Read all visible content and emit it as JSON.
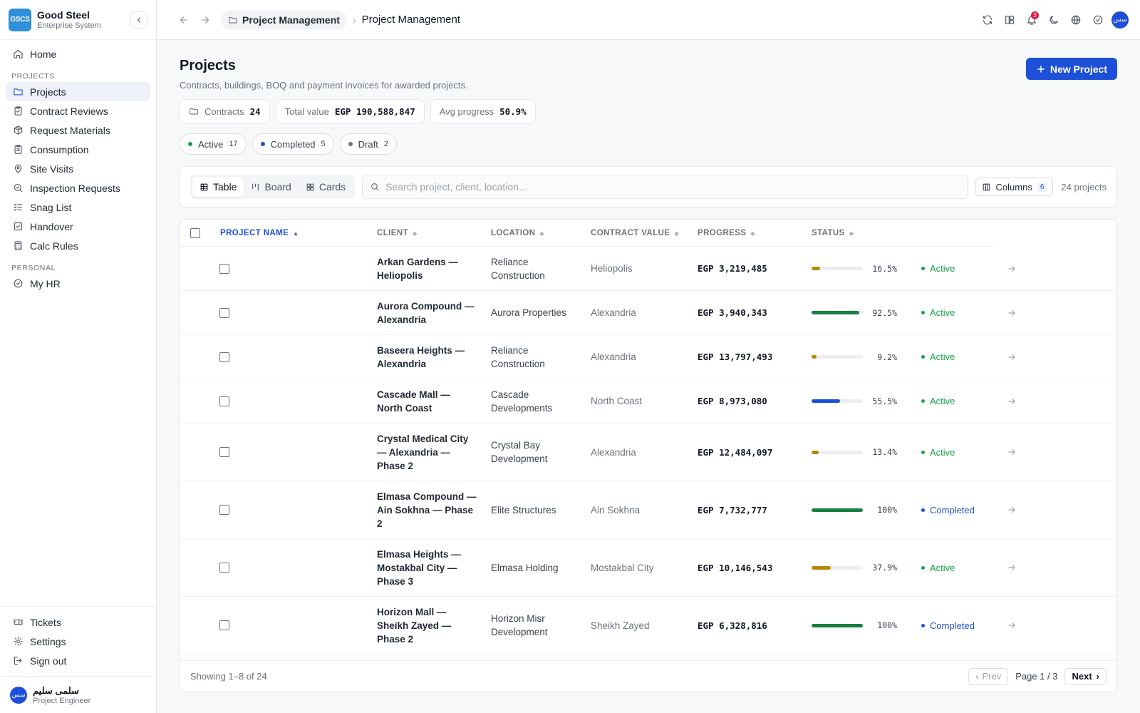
{
  "brand": {
    "logo": "GSCS",
    "name": "Good Steel",
    "subtitle": "Enterprise System"
  },
  "sidebar": {
    "home": "Home",
    "section_projects": "PROJECTS",
    "projects_items": [
      {
        "label": "Projects",
        "icon": "folder-icon",
        "active": true
      },
      {
        "label": "Contract Reviews",
        "icon": "clipboard-check-icon"
      },
      {
        "label": "Request Materials",
        "icon": "package-icon"
      },
      {
        "label": "Consumption",
        "icon": "clipboard-list-icon"
      },
      {
        "label": "Site Visits",
        "icon": "map-pin-icon"
      },
      {
        "label": "Inspection Requests",
        "icon": "search-check-icon"
      },
      {
        "label": "Snag List",
        "icon": "list-check-icon"
      },
      {
        "label": "Handover",
        "icon": "square-check-icon"
      },
      {
        "label": "Calc Rules",
        "icon": "calculator-icon"
      }
    ],
    "section_personal": "PERSONAL",
    "personal_items": [
      {
        "label": "My HR",
        "icon": "circle-check-icon"
      }
    ],
    "bottom_items": [
      {
        "label": "Tickets",
        "icon": "ticket-icon"
      },
      {
        "label": "Settings",
        "icon": "gear-icon"
      },
      {
        "label": "Sign out",
        "icon": "logout-icon"
      }
    ],
    "user": {
      "initials": "سس",
      "name": "سلمى سليم",
      "role": "Project Engineer"
    }
  },
  "topbar": {
    "breadcrumb_module": "Project Management",
    "breadcrumb_current": "Project Management",
    "notification_count": "3",
    "avatar_initials": "سس"
  },
  "page": {
    "title": "Projects",
    "subtitle": "Contracts, buildings, BOQ and payment invoices for awarded projects.",
    "new_button": "New Project"
  },
  "stats": [
    {
      "label": "Contracts",
      "value": "24"
    },
    {
      "label": "Total value",
      "value": "EGP 190,588,847"
    },
    {
      "label": "Avg progress",
      "value": "50.9%"
    }
  ],
  "filters": [
    {
      "label": "Active",
      "count": "17",
      "color": "#16a34a"
    },
    {
      "label": "Completed",
      "count": "5",
      "color": "#1e4fd8"
    },
    {
      "label": "Draft",
      "count": "2",
      "color": "#6b7280"
    }
  ],
  "toolbar": {
    "views": [
      "Table",
      "Board",
      "Cards"
    ],
    "active_view": "Table",
    "search_placeholder": "Search project, client, location...",
    "columns_label": "Columns",
    "columns_count": "6",
    "projects_count": "24 projects"
  },
  "table": {
    "columns": [
      "PROJECT NAME",
      "CLIENT",
      "LOCATION",
      "CONTRACT VALUE",
      "PROGRESS",
      "STATUS"
    ],
    "sorted_column": "PROJECT NAME",
    "rows": [
      {
        "name": "Arkan Gardens — Heliopolis",
        "client": "Reliance Construction",
        "location": "Heliopolis",
        "value": "EGP 3,219,485",
        "progress": 16.5,
        "progress_label": "16.5%",
        "status": "Active"
      },
      {
        "name": "Aurora Compound — Alexandria",
        "client": "Aurora Properties",
        "location": "Alexandria",
        "value": "EGP 3,940,343",
        "progress": 92.5,
        "progress_label": "92.5%",
        "status": "Active"
      },
      {
        "name": "Baseera Heights — Alexandria",
        "client": "Reliance Construction",
        "location": "Alexandria",
        "value": "EGP 13,797,493",
        "progress": 9.2,
        "progress_label": "9.2%",
        "status": "Active"
      },
      {
        "name": "Cascade Mall — North Coast",
        "client": "Cascade Developments",
        "location": "North Coast",
        "value": "EGP 8,973,080",
        "progress": 55.5,
        "progress_label": "55.5%",
        "status": "Active"
      },
      {
        "name": "Crystal Medical City — Alexandria — Phase 2",
        "client": "Crystal Bay Development",
        "location": "Alexandria",
        "value": "EGP 12,484,097",
        "progress": 13.4,
        "progress_label": "13.4%",
        "status": "Active"
      },
      {
        "name": "Elmasa Compound — Ain Sokhna — Phase 2",
        "client": "Elite Structures",
        "location": "Ain Sokhna",
        "value": "EGP 7,732,777",
        "progress": 100,
        "progress_label": "100%",
        "status": "Completed"
      },
      {
        "name": "Elmasa Heights — Mostakbal City — Phase 3",
        "client": "Elmasa Holding",
        "location": "Mostakbal City",
        "value": "EGP 10,146,543",
        "progress": 37.9,
        "progress_label": "37.9%",
        "status": "Active"
      },
      {
        "name": "Horizon Mall — Sheikh Zayed — Phase 2",
        "client": "Horizon Misr Development",
        "location": "Sheikh Zayed",
        "value": "EGP 6,328,816",
        "progress": 100,
        "progress_label": "100%",
        "status": "Completed"
      }
    ]
  },
  "footer": {
    "showing": "Showing 1–8 of 24",
    "prev": "Prev",
    "page": "Page 1 / 3",
    "next": "Next"
  },
  "colors": {
    "accent": "#1e4fd8",
    "active": "#16a34a",
    "completed": "#1e4fd8",
    "bar_low": "#b8860b",
    "bar_mid": "#1e4fd8",
    "bar_high": "#15803d"
  }
}
